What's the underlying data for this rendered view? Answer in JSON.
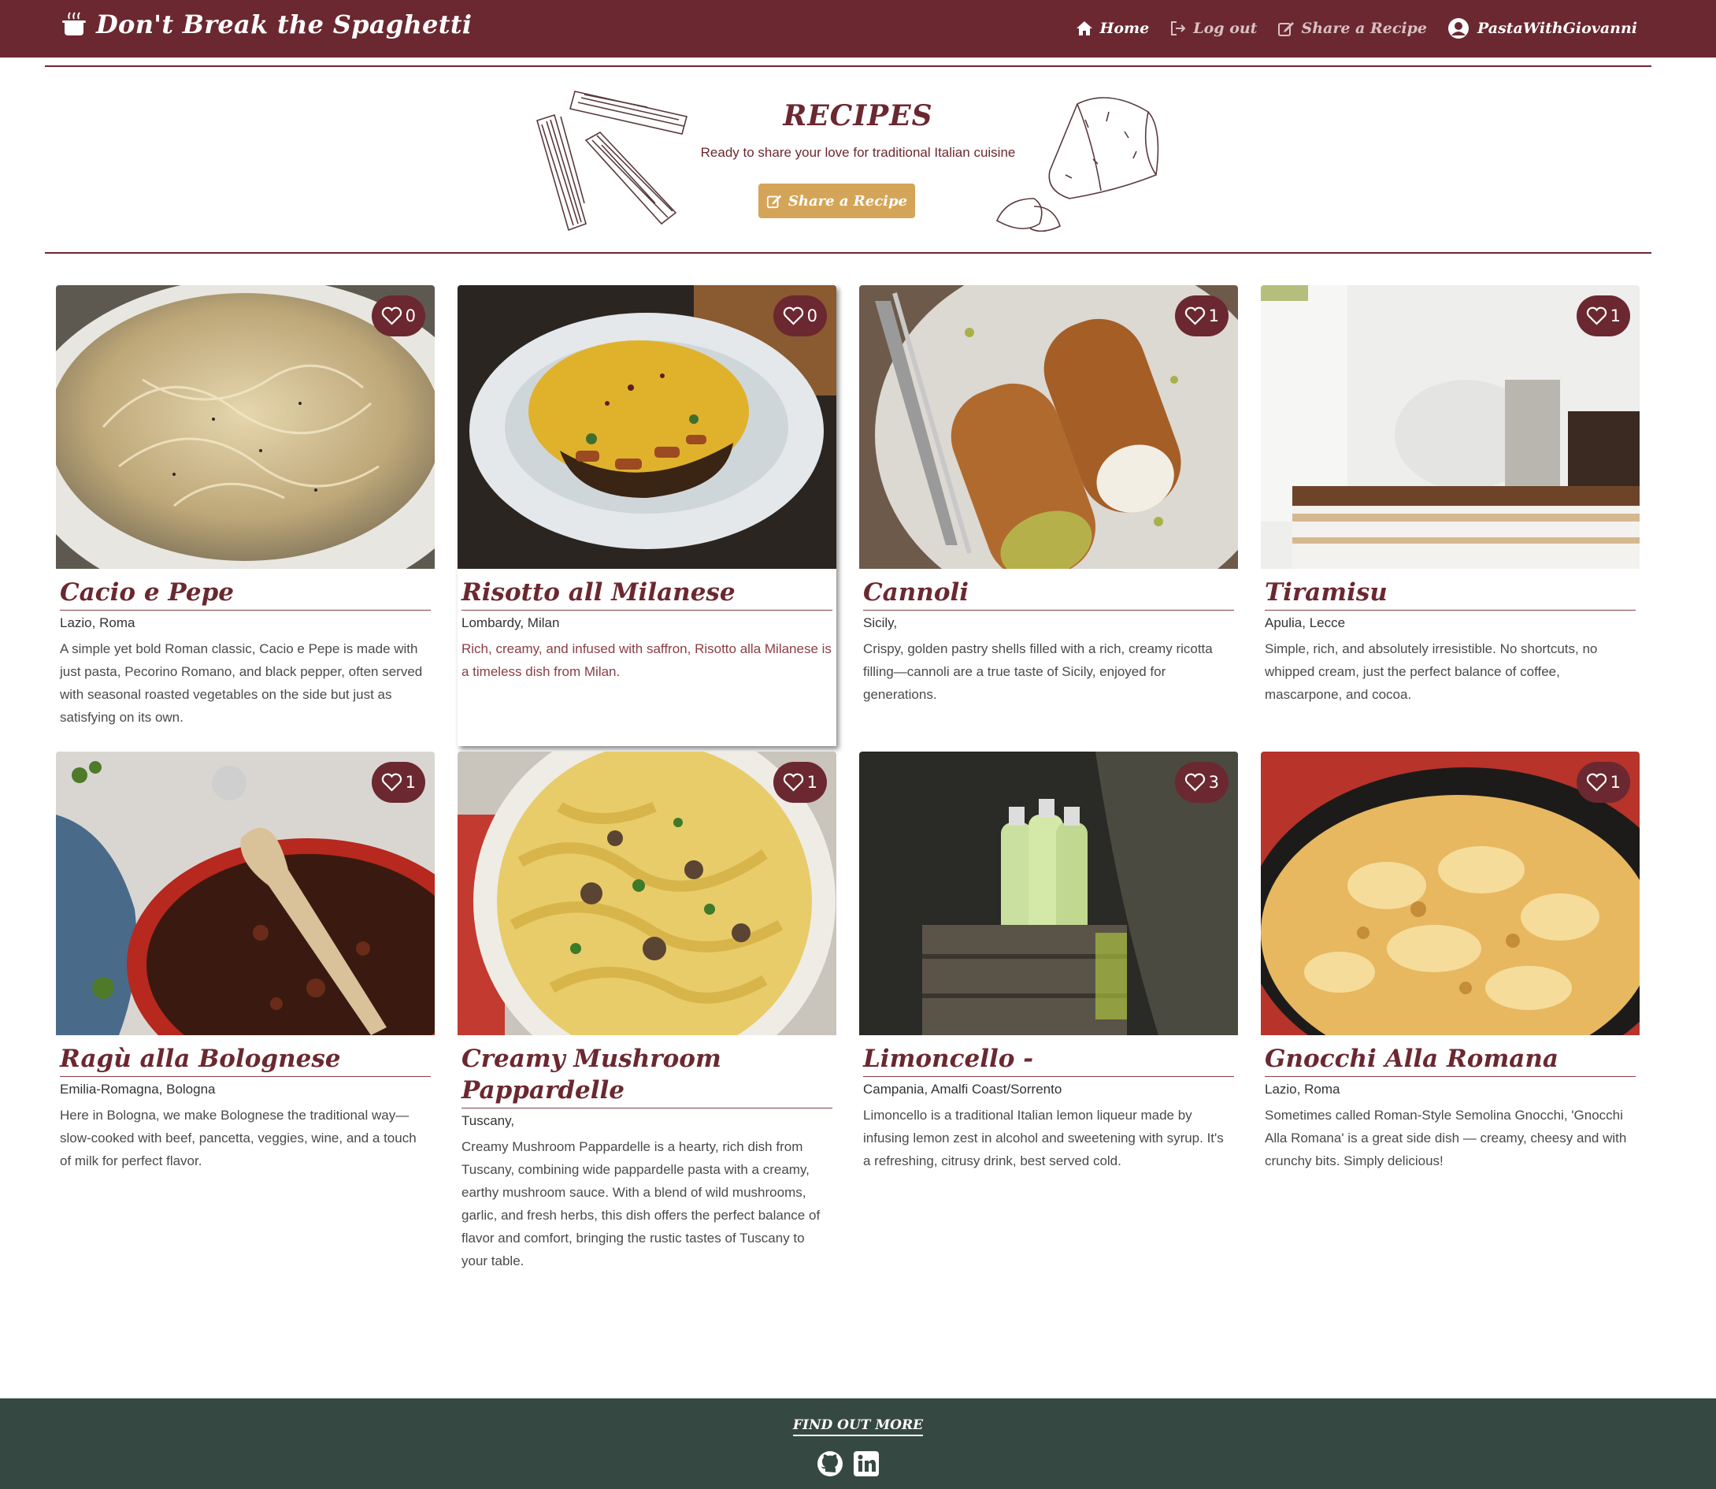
{
  "navbar": {
    "brand": "Don't Break the Spaghetti",
    "links": [
      {
        "label": "Home",
        "icon": "home-icon"
      },
      {
        "label": "Log out",
        "icon": "logout-icon"
      },
      {
        "label": "Share a Recipe",
        "icon": "edit-icon"
      }
    ],
    "username": "PastaWithGiovanni"
  },
  "hero": {
    "title": "RECIPES",
    "subtitle": "Ready to share your love for traditional Italian cuisine",
    "button_label": "Share a Recipe"
  },
  "recipes": [
    {
      "title": "Cacio e Pepe",
      "location": "Lazio, Roma",
      "likes": "0",
      "description": "A simple yet bold Roman classic, Cacio e Pepe is made with just pasta, Pecorino Romano, and black pepper, often served with seasonal roasted vegetables on the side but just as satisfying on its own."
    },
    {
      "title": "Risotto all Milanese",
      "location": "Lombardy, Milan",
      "likes": "0",
      "description": "Rich, creamy, and infused with saffron, Risotto alla Milanese is a timeless dish from Milan."
    },
    {
      "title": "Cannoli",
      "location": "Sicily,",
      "likes": "1",
      "description": "Crispy, golden pastry shells filled with a rich, creamy ricotta filling—cannoli are a true taste of Sicily, enjoyed for generations."
    },
    {
      "title": "Tiramisu",
      "location": "Apulia, Lecce",
      "likes": "1",
      "description": "Simple, rich, and absolutely irresistible. No shortcuts, no whipped cream, just the perfect balance of coffee, mascarpone, and cocoa."
    },
    {
      "title": "Ragù alla Bolognese",
      "location": "Emilia-Romagna, Bologna",
      "likes": "1",
      "description": "Here in Bologna, we make Bolognese the traditional way—slow-cooked with beef, pancetta, veggies, wine, and a touch of milk for perfect flavor."
    },
    {
      "title": "Creamy Mushroom Pappardelle",
      "location": "Tuscany,",
      "likes": "1",
      "description": "Creamy Mushroom Pappardelle is a hearty, rich dish from Tuscany, combining wide pappardelle pasta with a creamy, earthy mushroom sauce. With a blend of wild mushrooms, garlic, and fresh herbs, this dish offers the perfect balance of flavor and comfort, bringing the rustic tastes of Tuscany to your table."
    },
    {
      "title": "Limoncello -",
      "location": "Campania, Amalfi Coast/Sorrento",
      "likes": "3",
      "description": "Limoncello is a traditional Italian lemon liqueur made by infusing lemon zest in alcohol and sweetening with syrup. It's a refreshing, citrusy drink, best served cold."
    },
    {
      "title": "Gnocchi Alla Romana",
      "location": "Lazio, Roma",
      "likes": "1",
      "description": "Sometimes called Roman-Style Semolina Gnocchi, 'Gnocchi Alla Romana' is a great side dish — creamy, cheesy and with crunchy bits. Simply delicious!"
    }
  ],
  "footer": {
    "title": "FIND OUT MORE",
    "icons": [
      "github-icon",
      "linkedin-icon"
    ]
  },
  "colors": {
    "brand": "#6b2830",
    "accent": "#d4a558",
    "footer": "#364842"
  }
}
